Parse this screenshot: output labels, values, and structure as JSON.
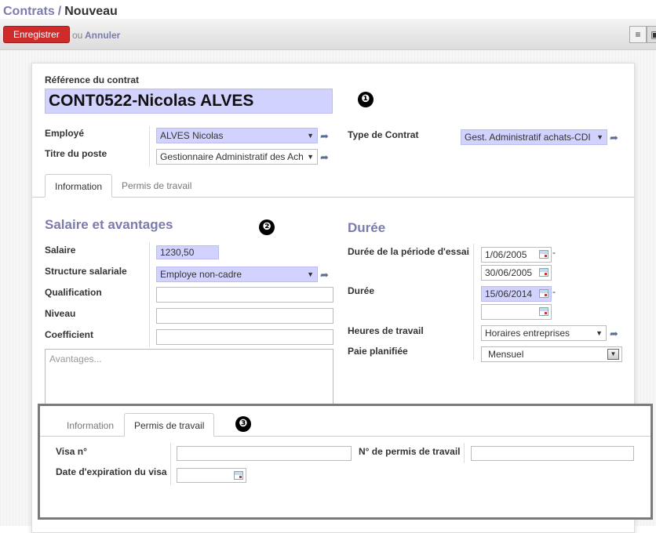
{
  "breadcrumb": {
    "parent": "Contrats",
    "separator": "/",
    "current": "Nouveau"
  },
  "toolbar": {
    "save_label": "Enregistrer",
    "or_text": "ou",
    "cancel_label": "Annuler"
  },
  "form": {
    "reference_label": "Référence du contrat",
    "reference_value": "CONT0522-Nicolas ALVES",
    "employee_label": "Employé",
    "employee_value": "ALVES Nicolas",
    "job_label": "Titre du poste",
    "job_value": "Gestionnaire Administratif des Ach",
    "contract_type_label": "Type de Contrat",
    "contract_type_value": "Gest. Administratif achats-CDI"
  },
  "tabs": [
    {
      "label": "Information"
    },
    {
      "label": "Permis de travail"
    }
  ],
  "salary": {
    "title": "Salaire et avantages",
    "wage_label": "Salaire",
    "wage_value": "1230,50",
    "structure_label": "Structure salariale",
    "structure_value": "Employe non-cadre",
    "qualification_label": "Qualification",
    "qualification_value": "",
    "level_label": "Niveau",
    "level_value": "",
    "coefficient_label": "Coefficient",
    "coefficient_value": "",
    "advantages_placeholder": "Avantages..."
  },
  "duration": {
    "title": "Durée",
    "trial_label": "Durée de la période d'essai",
    "trial_start": "1/06/2005",
    "trial_end": "30/06/2005",
    "dash": "-",
    "duration_label": "Durée",
    "duration_start": "15/06/2014",
    "duration_end": "",
    "hours_label": "Heures de travail",
    "hours_value": "Horaires entreprises",
    "pay_label": "Paie planifiée",
    "pay_value": "Mensuel"
  },
  "permit": {
    "tabs": [
      {
        "label": "Information"
      },
      {
        "label": "Permis de travail"
      }
    ],
    "visa_label": "Visa n°",
    "visa_value": "",
    "permit_no_label": "N° de permis de travail",
    "permit_no_value": "",
    "visa_expiry_label": "Date d'expiration du visa",
    "visa_expiry_value": ""
  },
  "markers": [
    "❶",
    "❷",
    "❸"
  ],
  "icons": {
    "external": "external-link-icon",
    "calendar": "calendar-icon",
    "dropdown": "chevron-down-icon",
    "list_view": "list-view-icon",
    "form_view": "form-view-icon"
  },
  "colors": {
    "accent": "#7c7bad",
    "save_button": "#cf2b2b",
    "required_field": "#d2d2ff"
  }
}
